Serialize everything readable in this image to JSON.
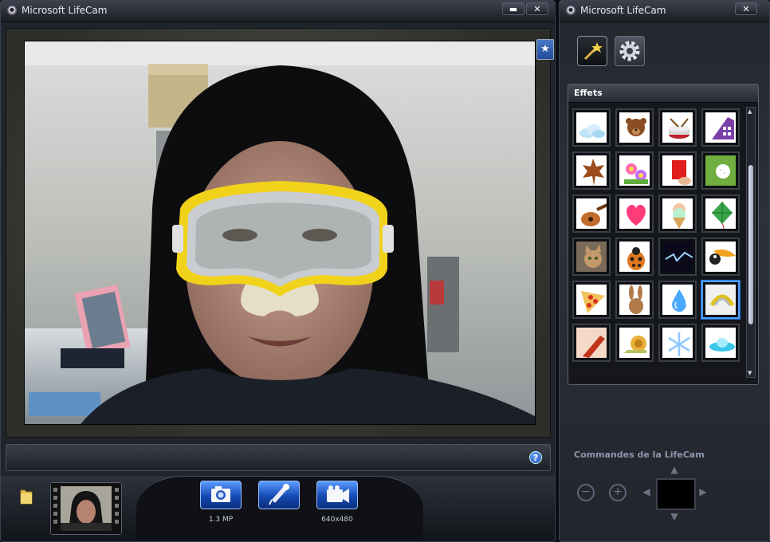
{
  "main_window": {
    "title": "Microsoft LifeCam",
    "minimize_label": "▬",
    "close_label": "✕"
  },
  "side_window": {
    "title": "Microsoft LifeCam",
    "close_label": "✕"
  },
  "toolbar": {
    "photo_resolution": "1.3 MP",
    "video_resolution": "640x480"
  },
  "help_label": "?",
  "effects": {
    "header": "Effets",
    "items": [
      "cloud",
      "teddy-bear",
      "drum",
      "purple-phone",
      "maple-leaf",
      "flowers",
      "red-card",
      "golf-ball",
      "guitar",
      "heart",
      "ice-cream",
      "kite",
      "cat",
      "ladybug",
      "lightning",
      "toucan",
      "pizza",
      "rabbit",
      "water-drop",
      "diving-mask",
      "guitar-red",
      "snail",
      "snowflake",
      "ufo"
    ],
    "selected": "diving-mask"
  },
  "controls": {
    "label": "Commandes de la LifeCam"
  },
  "colors": {
    "accent": "#2c6fd6",
    "button_blue": "#1649b4"
  }
}
